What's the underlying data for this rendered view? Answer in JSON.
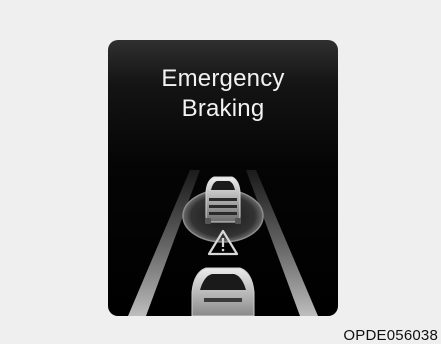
{
  "display": {
    "title_line1": "Emergency",
    "title_line2": "Braking"
  },
  "caption": "OPDE056038",
  "icons": {
    "lead_car": "car-rear-icon",
    "warning": "warning-triangle-icon",
    "own_car": "car-front-icon"
  },
  "colors": {
    "background": "#efefef",
    "display": "#000000",
    "text": "#f2f2f2",
    "road": "#b9b9b9"
  }
}
